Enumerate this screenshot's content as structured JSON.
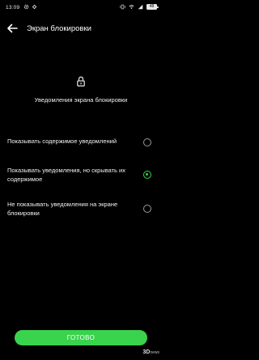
{
  "status_bar": {
    "time": "13:09",
    "battery": "48"
  },
  "header": {
    "title": "Экран блокировки"
  },
  "section": {
    "subtitle": "Уведомления экрана блокировки"
  },
  "options": [
    {
      "label": "Показывать содержимое уведомлений",
      "selected": false
    },
    {
      "label": "Показывать уведомления, но скрывать их содержимое",
      "selected": true
    },
    {
      "label": "Не показывать уведомления на экране блокировки",
      "selected": false
    }
  ],
  "footer": {
    "done_label": "ГОТОВО"
  },
  "watermark": {
    "brand": "3D",
    "sub": "news"
  },
  "colors": {
    "accent": "#39d34d",
    "background": "#000000"
  }
}
